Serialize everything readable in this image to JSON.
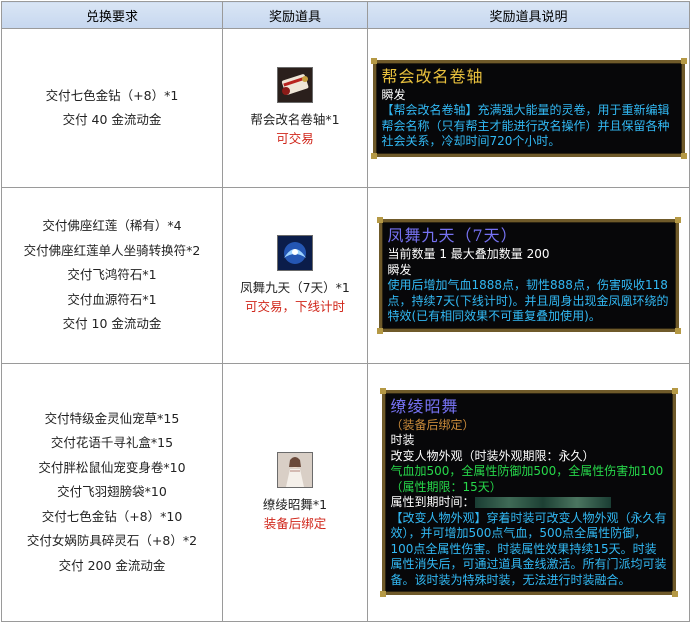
{
  "headers": {
    "requirements": "兑换要求",
    "reward": "奖励道具",
    "description": "奖励道具说明"
  },
  "rows": [
    {
      "requirements": [
        "交付七色金钻（+8）*1",
        "交付 40 金流动金"
      ],
      "reward": {
        "name": "帮会改名卷轴*1",
        "note": "可交易",
        "icon": "scroll-icon"
      },
      "tooltip": {
        "title": "帮会改名卷轴",
        "type": "瞬发",
        "lines": [
          "【帮会改名卷轴】充满强大能量的灵卷，用于重新编辑帮会名称（只有帮主才能进行改名操作）并且保留各种社会关系，冷却时间720个小时。"
        ]
      }
    },
    {
      "requirements": [
        "交付佛座红莲（稀有）*4",
        "交付佛座红莲单人坐骑转换符*2",
        "交付飞鸿符石*1",
        "交付血源符石*1",
        "交付 10 金流动金"
      ],
      "reward": {
        "name": "凤舞九天（7天）*1",
        "note": "可交易，下线计时",
        "icon": "phoenix-icon"
      },
      "tooltip": {
        "title": "凤舞九天（7天）",
        "count": "当前数量 1 最大叠加数量 200",
        "type": "瞬发",
        "lines": [
          "使用后增加气血1888点，韧性888点，伤害吸收118点，持续7天(下线计时)。并且周身出现金凤凰环绕的特效(已有相同效果不可重复叠加使用)。"
        ]
      }
    },
    {
      "requirements": [
        "交付特级金灵仙宠草*15",
        "交付花语千寻礼盒*15",
        "交付胖松鼠仙宠变身卷*10",
        "交付飞羽翅膀袋*10",
        "交付七色金钻（+8）*10",
        "交付女娲防具碎灵石（+8）*2",
        "交付 200 金流动金"
      ],
      "reward": {
        "name": "缭绫昭舞*1",
        "note": "装备后绑定",
        "icon": "costume-icon"
      },
      "tooltip": {
        "title": "缭绫昭舞",
        "bind": "（装备后绑定）",
        "category": "时装",
        "appearance": "改变人物外观（时装外观期限：永久）",
        "stats": "气血加500，全属性防御加500，全属性伤害加100（属性期限：15天）",
        "expiry_label": "属性到期时间：",
        "lines": [
          "【改变人物外观】穿着时装可改变人物外观（永久有效），并可增加500点气血，500点全属性防御，100点全属性伤害。时装属性效果持续15天。时装属性消失后，可通过道具金线激活。所有门派均可装备。该时装为特殊时装，无法进行时装融合。"
        ]
      }
    }
  ]
}
